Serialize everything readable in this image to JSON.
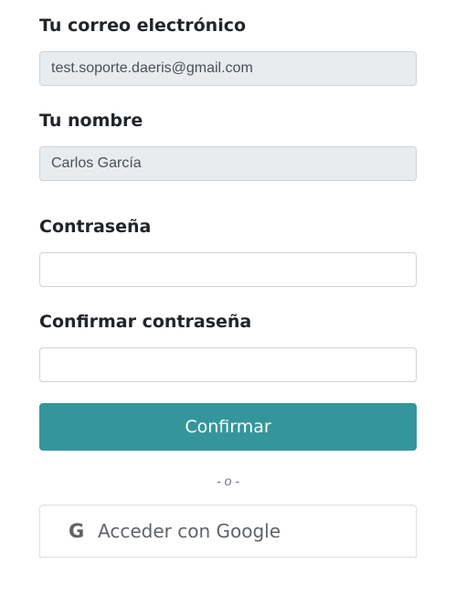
{
  "form": {
    "email": {
      "label": "Tu correo electrónico",
      "value": "test.soporte.daeris@gmail.com"
    },
    "name": {
      "label": "Tu nombre",
      "value": "Carlos García"
    },
    "password": {
      "label": "Contraseña",
      "value": ""
    },
    "confirm_password": {
      "label": "Confirmar contraseña",
      "value": ""
    },
    "confirm_button": "Confirmar",
    "separator": "- o -",
    "google_button": {
      "icon": "G",
      "label": "Acceder con Google"
    }
  },
  "colors": {
    "primary": "#34969b",
    "readonly_bg": "#e9ecef",
    "text": "#212529"
  }
}
